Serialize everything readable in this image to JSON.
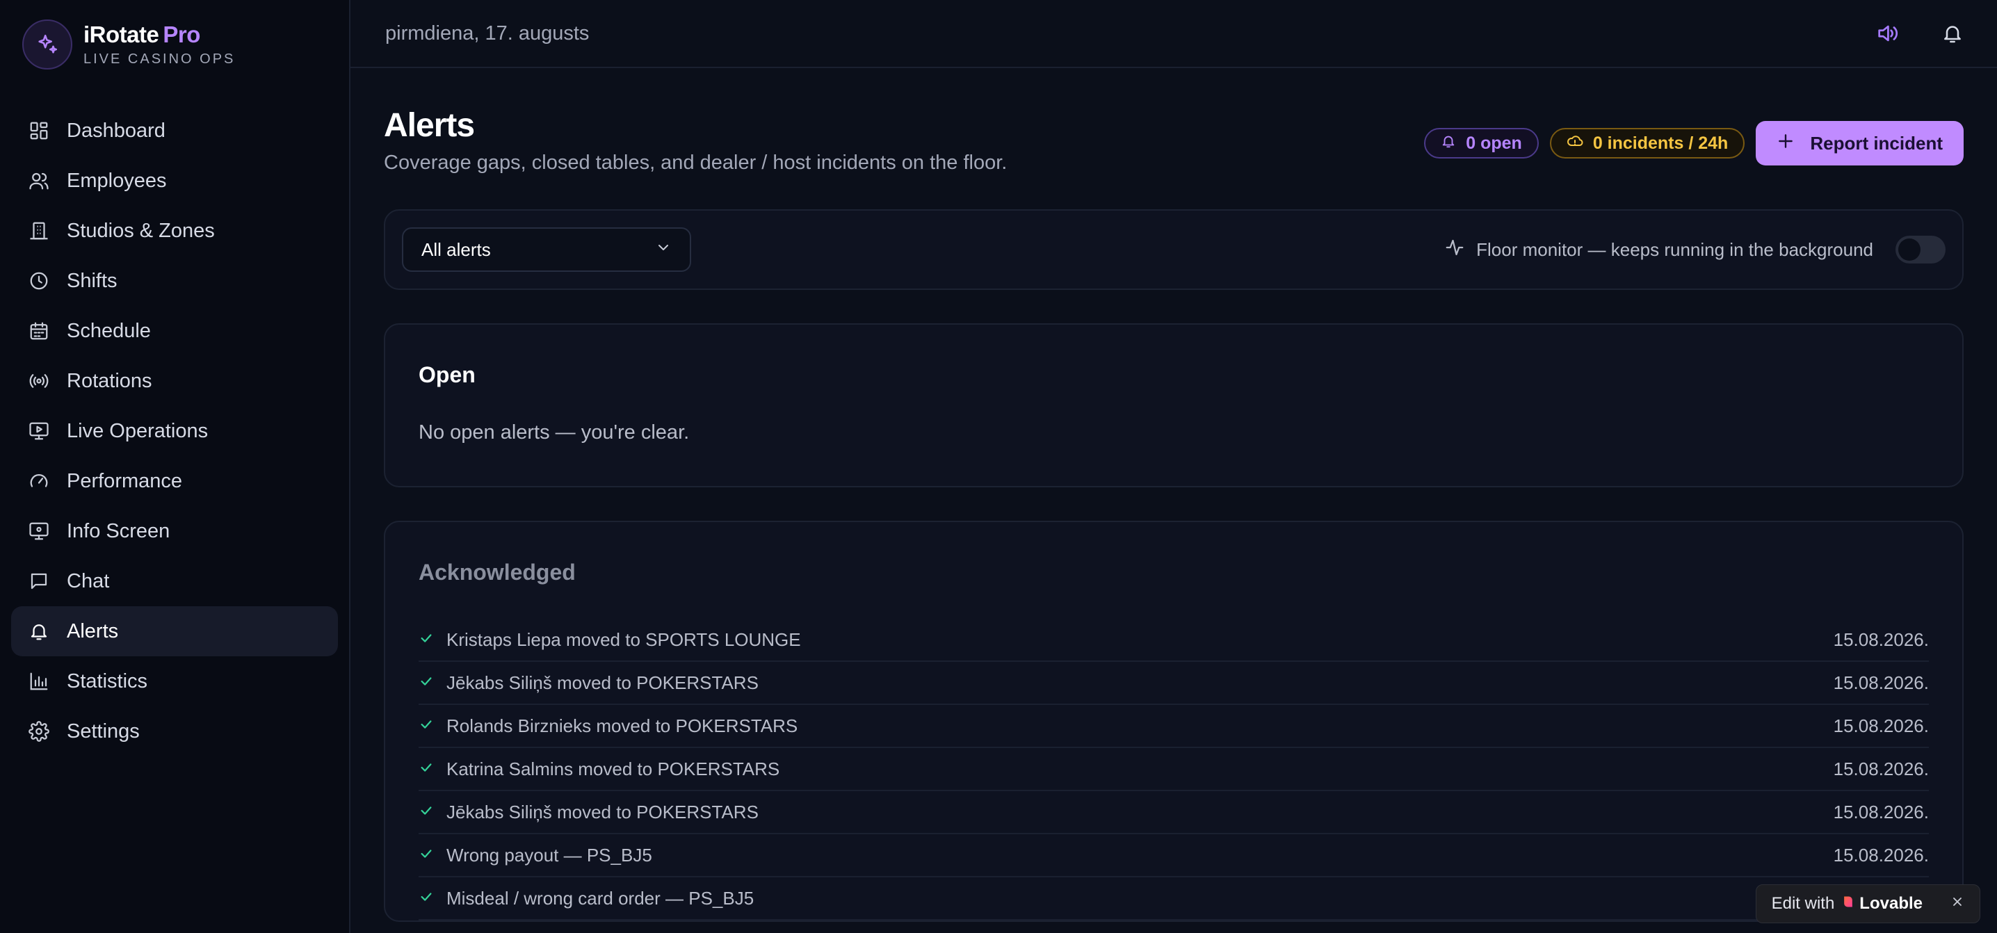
{
  "brand": {
    "name": "iRotate",
    "pro": "Pro",
    "subtitle": "LIVE CASINO OPS"
  },
  "sidebar": {
    "items": [
      {
        "label": "Dashboard",
        "icon": "dashboard-icon"
      },
      {
        "label": "Employees",
        "icon": "users-icon"
      },
      {
        "label": "Studios & Zones",
        "icon": "building-icon"
      },
      {
        "label": "Shifts",
        "icon": "clock-icon"
      },
      {
        "label": "Schedule",
        "icon": "calendar-icon"
      },
      {
        "label": "Rotations",
        "icon": "broadcast-icon"
      },
      {
        "label": "Live Operations",
        "icon": "monitor-play-icon"
      },
      {
        "label": "Performance",
        "icon": "gauge-icon"
      },
      {
        "label": "Info Screen",
        "icon": "screen-icon"
      },
      {
        "label": "Chat",
        "icon": "chat-icon"
      },
      {
        "label": "Alerts",
        "icon": "bell-icon",
        "active": true
      },
      {
        "label": "Statistics",
        "icon": "bar-chart-icon"
      },
      {
        "label": "Settings",
        "icon": "gear-icon"
      }
    ]
  },
  "header": {
    "date": "pirmdiena, 17. augusts"
  },
  "page": {
    "title": "Alerts",
    "subtitle": "Coverage gaps, closed tables, and dealer / host incidents on the floor.",
    "open_badge": "0 open",
    "incidents_badge": "0 incidents / 24h",
    "report_button": "Report incident"
  },
  "filter": {
    "selected": "All alerts",
    "monitor_label": "Floor monitor — keeps running in the background",
    "monitor_on": false
  },
  "open_section": {
    "title": "Open",
    "empty": "No open alerts — you're clear."
  },
  "ack_section": {
    "title": "Acknowledged",
    "rows": [
      {
        "text": "Kristaps Liepa moved to SPORTS LOUNGE",
        "date": "15.08.2026."
      },
      {
        "text": "Jēkabs Siliņš moved to POKERSTARS",
        "date": "15.08.2026."
      },
      {
        "text": "Rolands Birznieks moved to POKERSTARS",
        "date": "15.08.2026."
      },
      {
        "text": "Katrina Salmins moved to POKERSTARS",
        "date": "15.08.2026."
      },
      {
        "text": "Jēkabs Siliņš moved to POKERSTARS",
        "date": "15.08.2026."
      },
      {
        "text": "Wrong payout — PS_BJ5",
        "date": "15.08.2026."
      },
      {
        "text": "Misdeal / wrong card order — PS_BJ5",
        "date": ""
      }
    ]
  },
  "lovable": {
    "prefix": "Edit with",
    "brand": "Lovable"
  },
  "colors": {
    "accent": "#c08bff",
    "warning": "#f5c542",
    "success": "#34d399"
  }
}
